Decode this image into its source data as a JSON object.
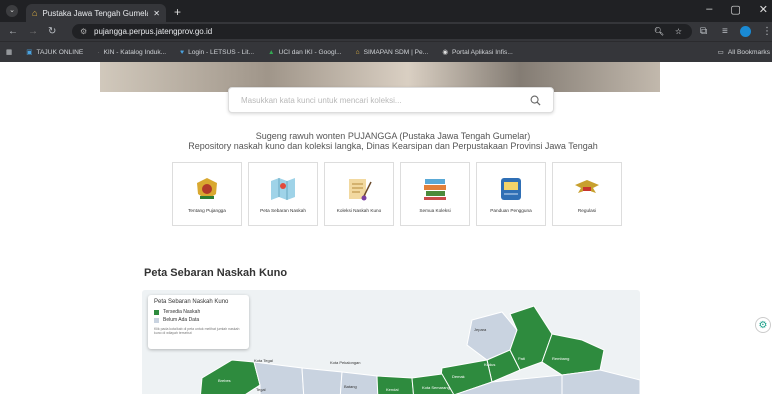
{
  "browser": {
    "tab_title": "Pustaka Jawa Tengah Gumelar",
    "url": "pujangga.perpus.jatengprov.go.id",
    "bookmarks": [
      "TAJUK ONLINE",
      "KIN - Katalog Induk...",
      "Login - LETSUS - Lit...",
      "UCI dan IKI - Googl...",
      "SIMAPAN SDM | Pe...",
      "Portal Aplikasi Infis..."
    ],
    "all_bookmarks": "All Bookmarks"
  },
  "search": {
    "placeholder": "Masukkan kata kunci untuk mencari koleksi..."
  },
  "welcome": {
    "line1": "Sugeng rawuh wonten PUJANGGA (Pustaka Jawa Tengah Gumelar)",
    "line2": "Repository naskah kuno dan koleksi langka, Dinas Kearsipan dan Perpustakaan Provinsi Jawa Tengah"
  },
  "cards": [
    {
      "label": "Tentang Pujangga",
      "icon": "emblem-icon"
    },
    {
      "label": "Peta Sebaran Naskah",
      "icon": "map-icon"
    },
    {
      "label": "Koleksi Naskah Kuno",
      "icon": "scroll-icon"
    },
    {
      "label": "Semua Koleksi",
      "icon": "books-icon"
    },
    {
      "label": "Panduan Pengguna",
      "icon": "guide-icon"
    },
    {
      "label": "Regulasi",
      "icon": "garuda-icon"
    }
  ],
  "section_title": "Peta Sebaran Naskah Kuno",
  "map": {
    "legend_title": "Peta Sebaran Naskah Kuno",
    "legend": [
      {
        "label": "Tersedia Naskah",
        "color": "#2e8b3e"
      },
      {
        "label": "Belum Ada Data",
        "color": "#c9d3e0"
      }
    ],
    "note": "Klik pada kota/kab di peta untuk melihat jumlah naskah kuno di wilayah tersebut",
    "regions": [
      "Kota Tegal",
      "Kota Pekalongan",
      "Jepara",
      "Kudus",
      "Pati",
      "Rembang",
      "Brebes",
      "Tegal",
      "Batang",
      "Kendal",
      "Kota Semarang",
      "Demak"
    ]
  },
  "colors": {
    "available": "#2e8b3e",
    "empty": "#c9d3e0"
  }
}
